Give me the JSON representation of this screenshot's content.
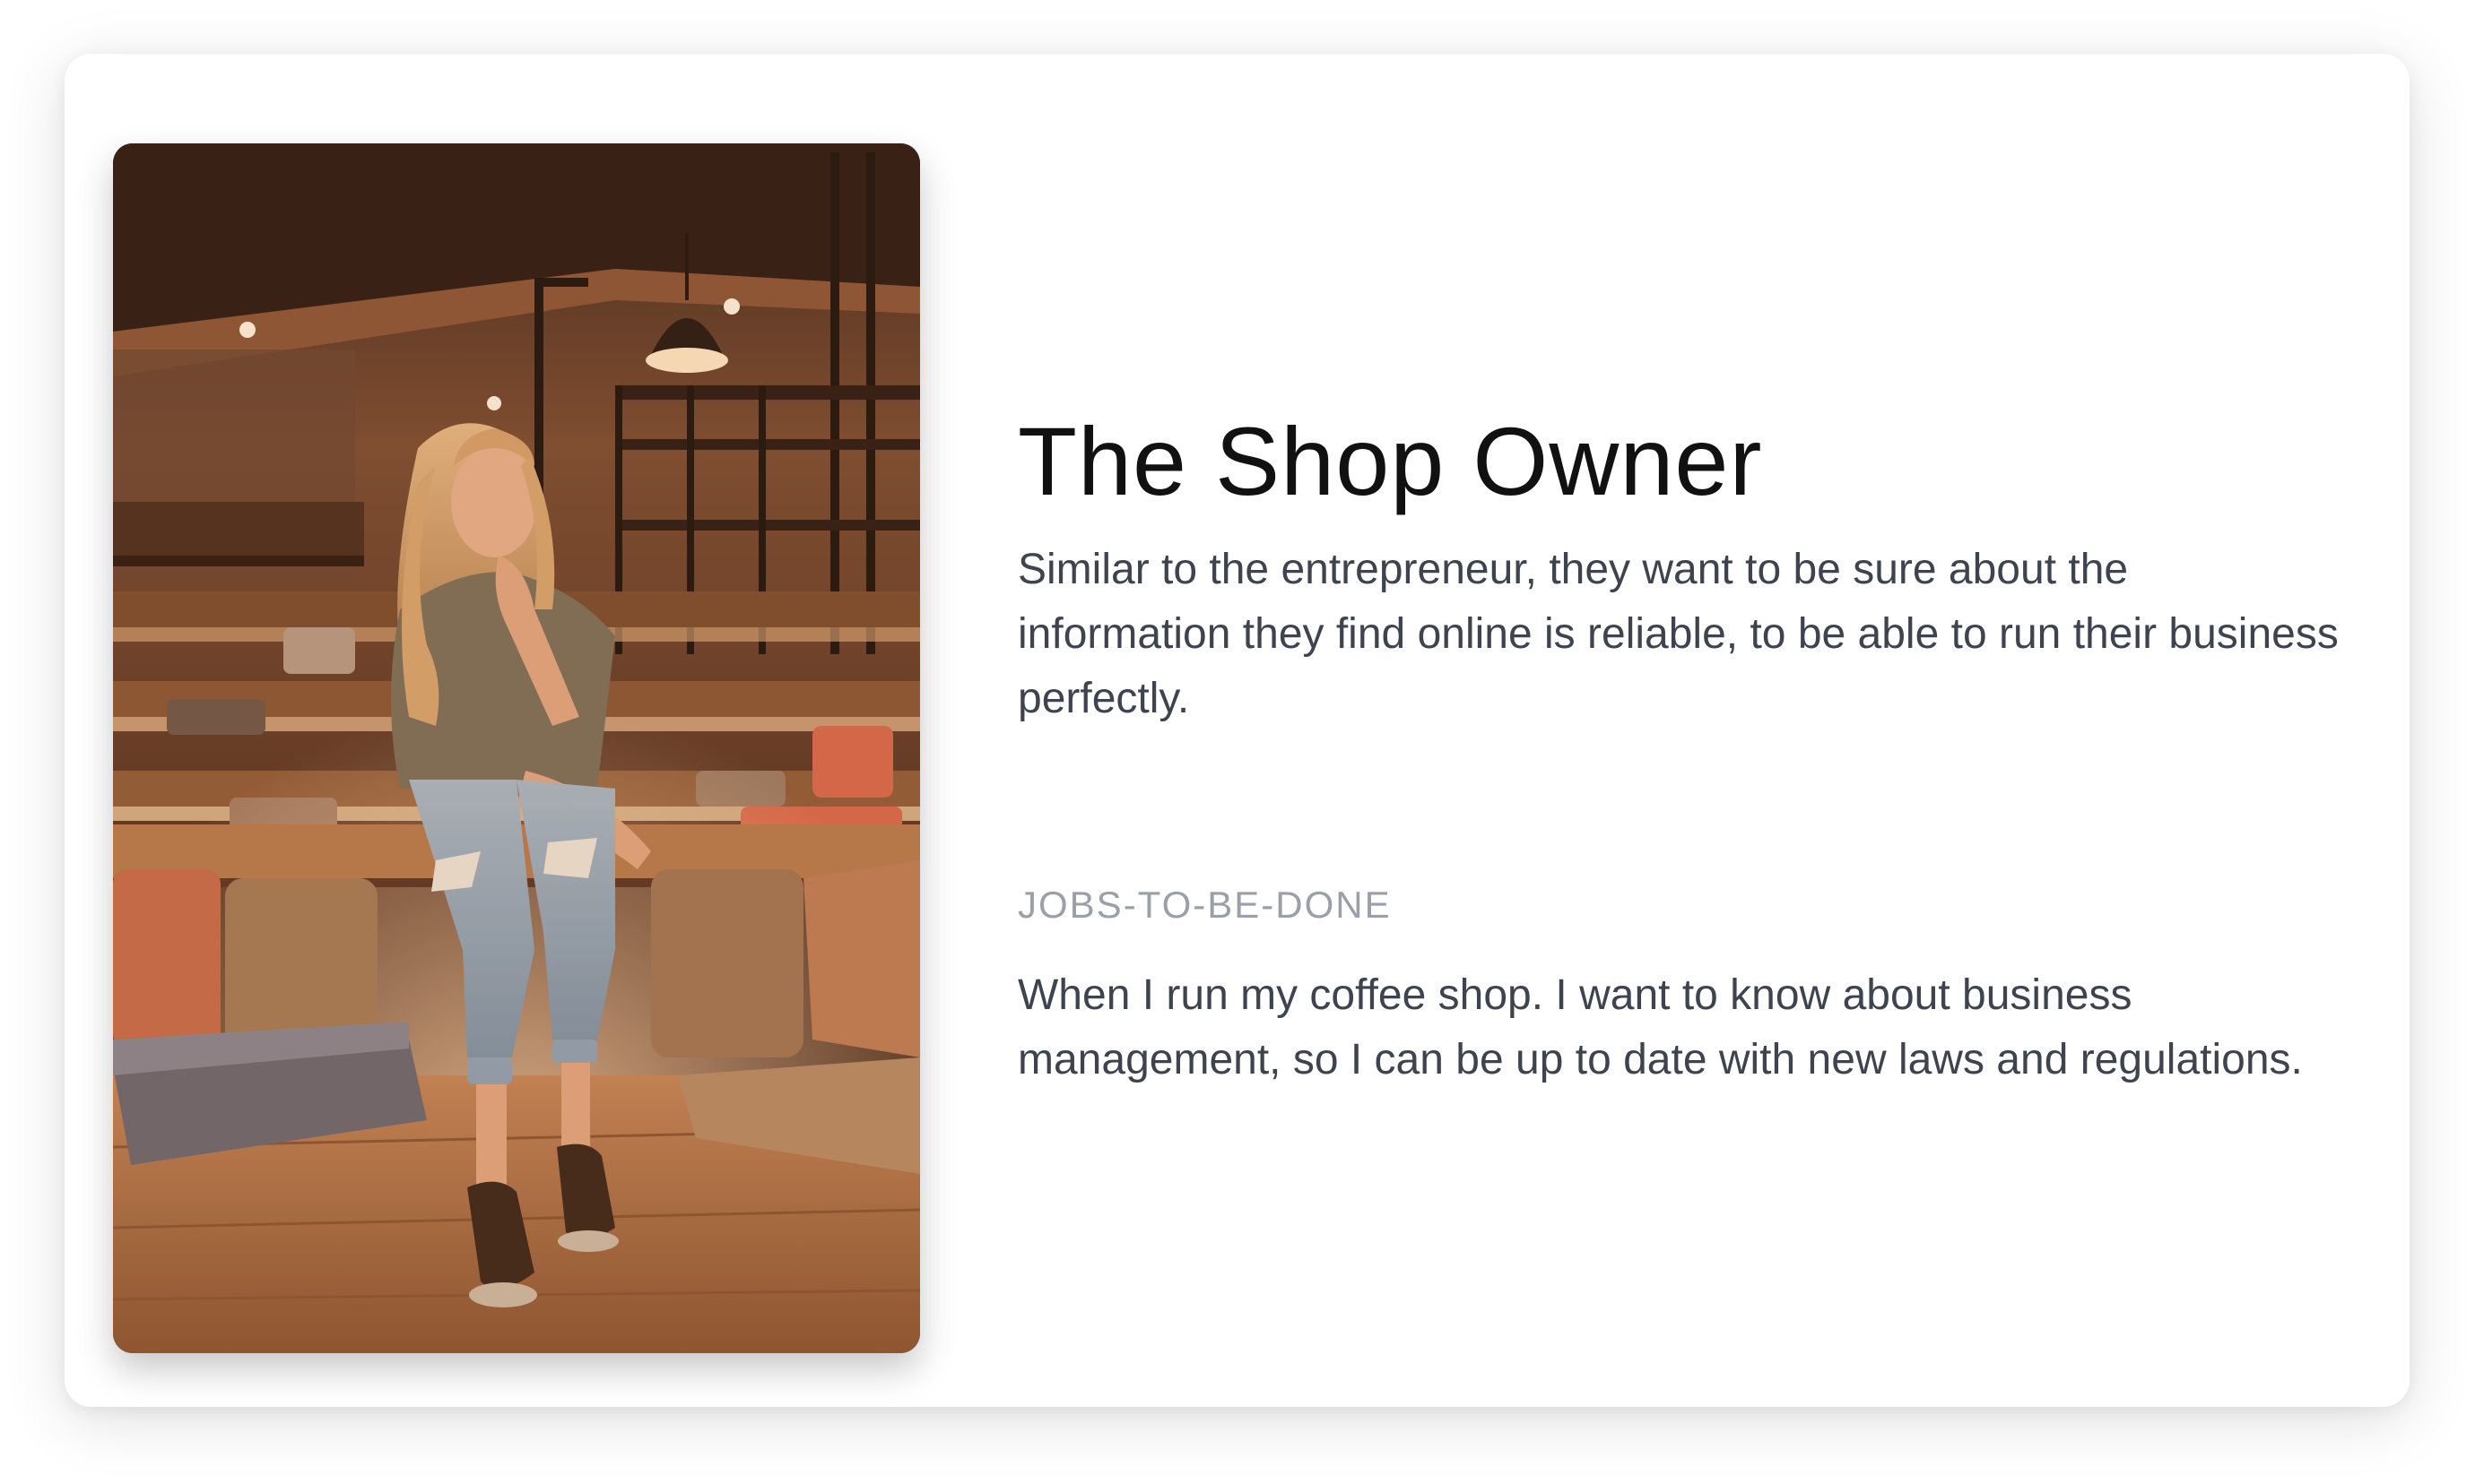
{
  "persona": {
    "title": "The Shop Owner",
    "description": "Similar to the entrepreneur, they want to be sure about the information they find online is reliable, to be able to run their business perfectly.",
    "jobs_label": "JOBS-TO-BE-DONE",
    "jobs_text": "When I run my coffee shop. I want to know about business management, so I can be up to date with new laws and regulations."
  },
  "photo": {
    "alt": "Woman sitting on cushioned bench in a warm-lit coffee shop",
    "tone_color": "#b06a3c"
  }
}
